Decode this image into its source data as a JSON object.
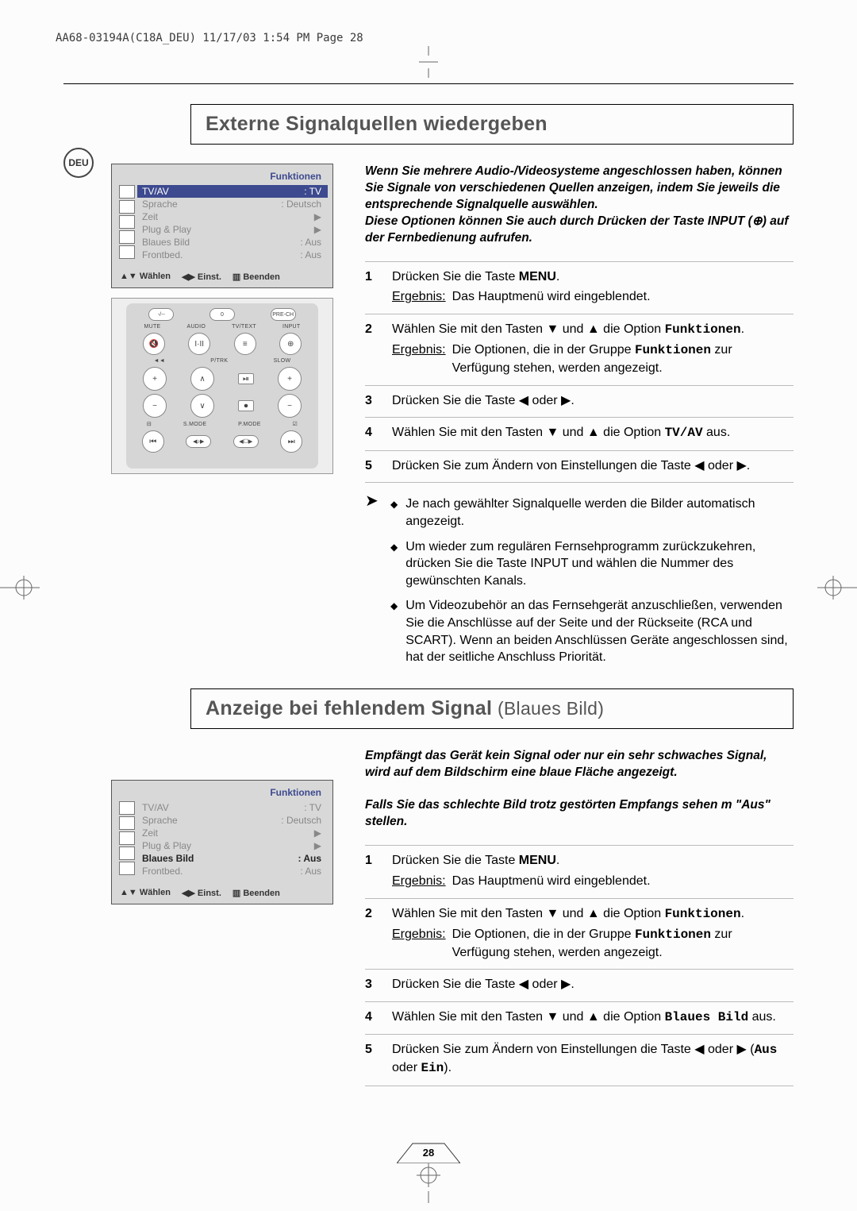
{
  "header_line": "AA68-03194A(C18A_DEU)  11/17/03  1:54 PM  Page 28",
  "deu_badge": "DEU",
  "page_number": "28",
  "section1": {
    "title": "Externe Signalquellen wiedergeben",
    "osd": {
      "title": "Funktionen",
      "rows": [
        {
          "label": "TV/AV",
          "value": ": TV",
          "kind": "active"
        },
        {
          "label": "Sprache",
          "value": ": Deutsch",
          "kind": ""
        },
        {
          "label": "Zeit",
          "value": "▶",
          "kind": ""
        },
        {
          "label": "Plug & Play",
          "value": "▶",
          "kind": ""
        },
        {
          "label": "Blaues Bild",
          "value": ": Aus",
          "kind": ""
        },
        {
          "label": "Frontbed.",
          "value": ": Aus",
          "kind": ""
        }
      ],
      "hints": [
        "▲▼ Wählen",
        "◀▶ Einst.",
        "▥ Beenden"
      ]
    },
    "remote": {
      "row1": [
        "-/--",
        "0",
        "PRE-CH"
      ],
      "row2_labels": [
        "MUTE",
        "AUDIO",
        "TV/TEXT",
        "INPUT"
      ],
      "row2_btns": [
        "🔇",
        "I·II",
        "≡",
        "⊕"
      ],
      "row3_labels": [
        "◄◄",
        "",
        "P/TRK",
        "SLOW"
      ],
      "row4_btns": [
        "+",
        "∧",
        "⏯",
        "+"
      ],
      "row5_btns": [
        "−",
        "∨",
        "⏺",
        "−"
      ],
      "row6_labels": [
        "⊟",
        "S.MODE",
        "P.MODE",
        "☑"
      ],
      "row7_btns": [
        "⏮",
        "◀♪▶",
        "◀☐▶",
        "⏭"
      ]
    },
    "intro": "Wenn Sie mehrere Audio-/Videosysteme angeschlossen haben, können Sie Signale von verschiedenen Quellen anzeigen, indem Sie jeweils die entsprechende Signalquelle auswählen.\nDiese Optionen können Sie auch durch Drücken der Taste INPUT (⊕) auf der Fernbedienung aufrufen.",
    "steps": [
      {
        "n": "1",
        "body_pre": "Drücken Sie die Taste ",
        "body_bold": "MENU",
        "body_post": ".",
        "result_label": "Ergebnis:",
        "result": "Das Hauptmenü wird eingeblendet."
      },
      {
        "n": "2",
        "body_pre": "Wählen Sie mit den Tasten ▼ und ▲ die Option ",
        "body_mono": "Funktionen",
        "body_post": ".",
        "result_label": "Ergebnis:",
        "result_pre": "Die Optionen, die in der Gruppe ",
        "result_mono": "Funktionen",
        "result_post": " zur Verfügung stehen, werden angezeigt."
      },
      {
        "n": "3",
        "body": "Drücken Sie die Taste ◀ oder ▶."
      },
      {
        "n": "4",
        "body_pre": "Wählen Sie mit den Tasten ▼ und ▲ die Option ",
        "body_mono": "TV/AV",
        "body_post": " aus."
      },
      {
        "n": "5",
        "body": "Drücken Sie zum Ändern von Einstellungen die Taste ◀ oder ▶."
      }
    ],
    "bullets": [
      "Je nach gewählter Signalquelle werden die Bilder automatisch angezeigt.",
      "Um wieder zum regulären Fernsehprogramm zurückzukehren, drücken Sie die Taste INPUT und wählen die Nummer des gewünschten Kanals.",
      "Um Videozubehör an das Fernsehgerät anzuschließen, verwenden Sie die Anschlüsse auf der Seite und der Rückseite (RCA und SCART). Wenn an beiden Anschlüssen Geräte angeschlossen sind, hat der seitliche Anschluss Priorität."
    ]
  },
  "section2": {
    "title": "Anzeige bei fehlendem Signal",
    "subtitle": " (Blaues Bild)",
    "osd": {
      "title": "Funktionen",
      "rows": [
        {
          "label": "TV/AV",
          "value": ": TV",
          "kind": ""
        },
        {
          "label": "Sprache",
          "value": ": Deutsch",
          "kind": ""
        },
        {
          "label": "Zeit",
          "value": "▶",
          "kind": ""
        },
        {
          "label": "Plug & Play",
          "value": "▶",
          "kind": ""
        },
        {
          "label": "Blaues Bild",
          "value": ": Aus",
          "kind": "emph"
        },
        {
          "label": "Frontbed.",
          "value": ": Aus",
          "kind": ""
        }
      ],
      "hints": [
        "▲▼ Wählen",
        "◀▶ Einst.",
        "▥ Beenden"
      ]
    },
    "intro": "Empfängt das Gerät kein Signal oder nur ein sehr schwaches Signal, wird auf dem Bildschirm eine blaue Fläche angezeigt.\n\nFalls Sie das schlechte Bild trotz gestörten Empfangs sehen m \"Aus\" stellen.",
    "steps": [
      {
        "n": "1",
        "body_pre": "Drücken Sie die Taste ",
        "body_bold": "MENU",
        "body_post": ".",
        "result_label": "Ergebnis:",
        "result": "Das Hauptmenü wird eingeblendet."
      },
      {
        "n": "2",
        "body_pre": "Wählen Sie mit den Tasten ▼ und ▲ die Option ",
        "body_mono": "Funktionen",
        "body_post": ".",
        "result_label": "Ergebnis:",
        "result_pre": "Die Optionen, die in der Gruppe ",
        "result_mono": "Funktionen",
        "result_post": " zur Verfügung stehen, werden angezeigt."
      },
      {
        "n": "3",
        "body": "Drücken Sie die Taste ◀ oder ▶."
      },
      {
        "n": "4",
        "body_pre": "Wählen Sie mit den Tasten ▼ und ▲ die Option ",
        "body_mono": "Blaues Bild",
        "body_post": " aus."
      },
      {
        "n": "5",
        "body_pre": "Drücken Sie zum Ändern von Einstellungen die Taste ◀ oder ▶ (",
        "body_mono": "Aus",
        "body_mid": " oder ",
        "body_mono2": "Ein",
        "body_post": ")."
      }
    ]
  }
}
